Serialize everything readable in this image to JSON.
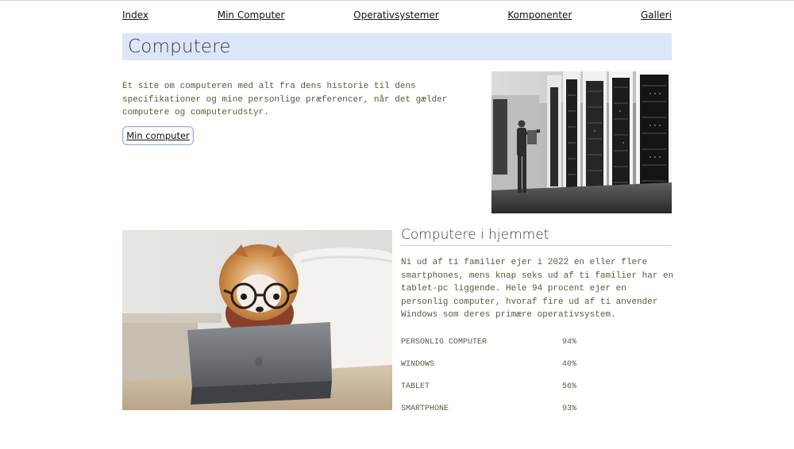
{
  "nav": {
    "items": [
      {
        "label": "Index"
      },
      {
        "label": "Min Computer"
      },
      {
        "label": "Operativsystemer"
      },
      {
        "label": "Komponenter"
      },
      {
        "label": "Galleri"
      }
    ]
  },
  "hero": {
    "title": "Computere",
    "intro": "Et site om computeren med alt fra dens historie til dens specifikationer og mine personlige præferencer, når det gælder computere og computerudstyr.",
    "button_label": "Min computer"
  },
  "home": {
    "title": "Computere i hjemmet",
    "paragraph": "Ni ud af ti familier ejer i 2022 en eller flere smartphones, mens knap seks ud af ti familier har en tablet-pc liggende. Hele 94 procent ejer en personlig computer, hvoraf fire ud af ti anvender Windows som deres primære operativsystem.",
    "stats": [
      {
        "label": "PERSONLIG COMPUTER",
        "value": "94%"
      },
      {
        "label": "WINDOWS",
        "value": "40%"
      },
      {
        "label": "TABLET",
        "value": "56%"
      },
      {
        "label": "SMARTPHONE",
        "value": "93%"
      }
    ]
  },
  "colors": {
    "hero_bar": "#dbe6f8",
    "button_border": "#8fb0dc",
    "body_text": "#5a5a3a"
  }
}
